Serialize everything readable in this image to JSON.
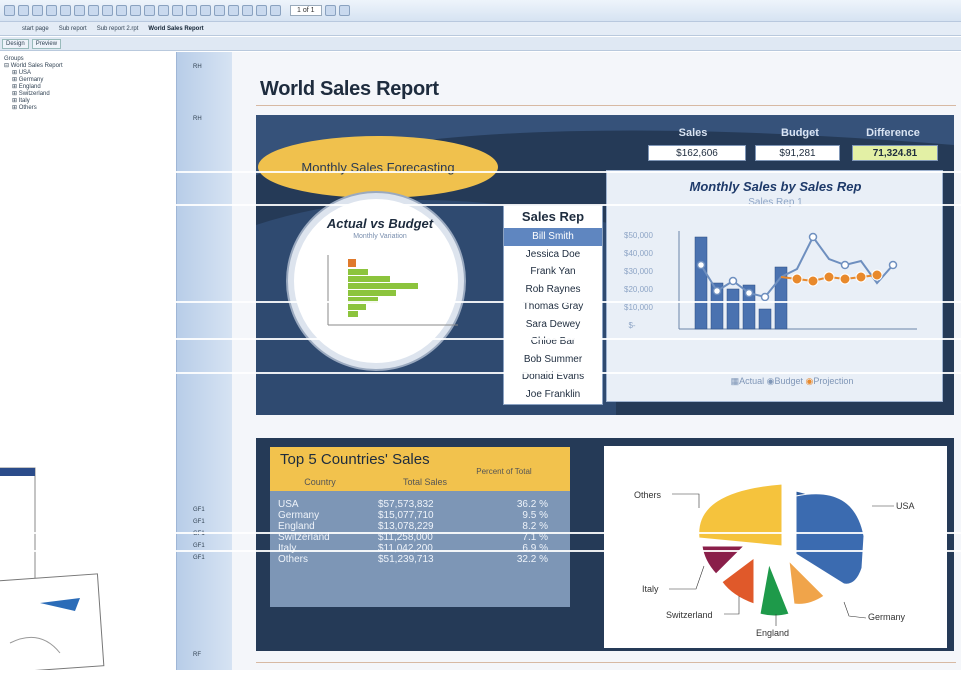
{
  "toolbar": {
    "page_indicator": "1 of 1"
  },
  "tabs": {
    "top": [
      "start page",
      "Sub report",
      "Sub report 2.rpt",
      "World Sales Report"
    ],
    "views": [
      "Design",
      "Preview"
    ]
  },
  "tree": {
    "root": "World Sales Report",
    "items": [
      "USA",
      "Germany",
      "England",
      "Switzerland",
      "Italy",
      "Others"
    ],
    "header": "Groups"
  },
  "report": {
    "title": "World Sales Report",
    "forecast_label": "Monthly Sales Forecasting",
    "kpi": {
      "sales_label": "Sales",
      "sales_value": "$162,606",
      "budget_label": "Budget",
      "budget_value": "$91,281",
      "diff_label": "Difference",
      "diff_value": "71,324.81"
    },
    "actual_vs_budget": {
      "title": "Actual vs Budget",
      "subtitle": "Monthly Variation"
    },
    "sales_rep": {
      "header": "Sales Rep",
      "names": [
        "Bill Smith",
        "Jessica Doe",
        "Frank Yan",
        "Rob Raynes",
        "Thomas Gray",
        "Sara Dewey",
        "Chloe Bar",
        "Bob Summer",
        "Donald Evans",
        "Joe Franklin"
      ]
    },
    "monthly_chart": {
      "title": "Monthly Sales by Sales Rep",
      "subtitle": "Sales Rep 1",
      "legend": [
        "Actual",
        "Budget",
        "Projection"
      ]
    },
    "top5": {
      "title": "Top 5 Countries' Sales",
      "columns": [
        "Country",
        "Total Sales",
        "Percent of Total"
      ],
      "rows": [
        [
          "USA",
          "$57,573,832",
          "36.2 %"
        ],
        [
          "Germany",
          "$15,077,710",
          "9.5 %"
        ],
        [
          "England",
          "$13,078,229",
          "8.2 %"
        ],
        [
          "Switzerland",
          "$11,258,000",
          "7.1 %"
        ],
        [
          "Italy",
          "$11,042,200",
          "6.9 %"
        ],
        [
          "Others",
          "$51,239,713",
          "32.2 %"
        ]
      ]
    },
    "pie_labels": [
      "USA",
      "Germany",
      "England",
      "Switzerland",
      "Italy",
      "Others"
    ]
  },
  "colors": {
    "panel": "#253a57",
    "accent": "#f0c14d",
    "bar": "#4a72b0",
    "projection": "#e8892c"
  }
}
